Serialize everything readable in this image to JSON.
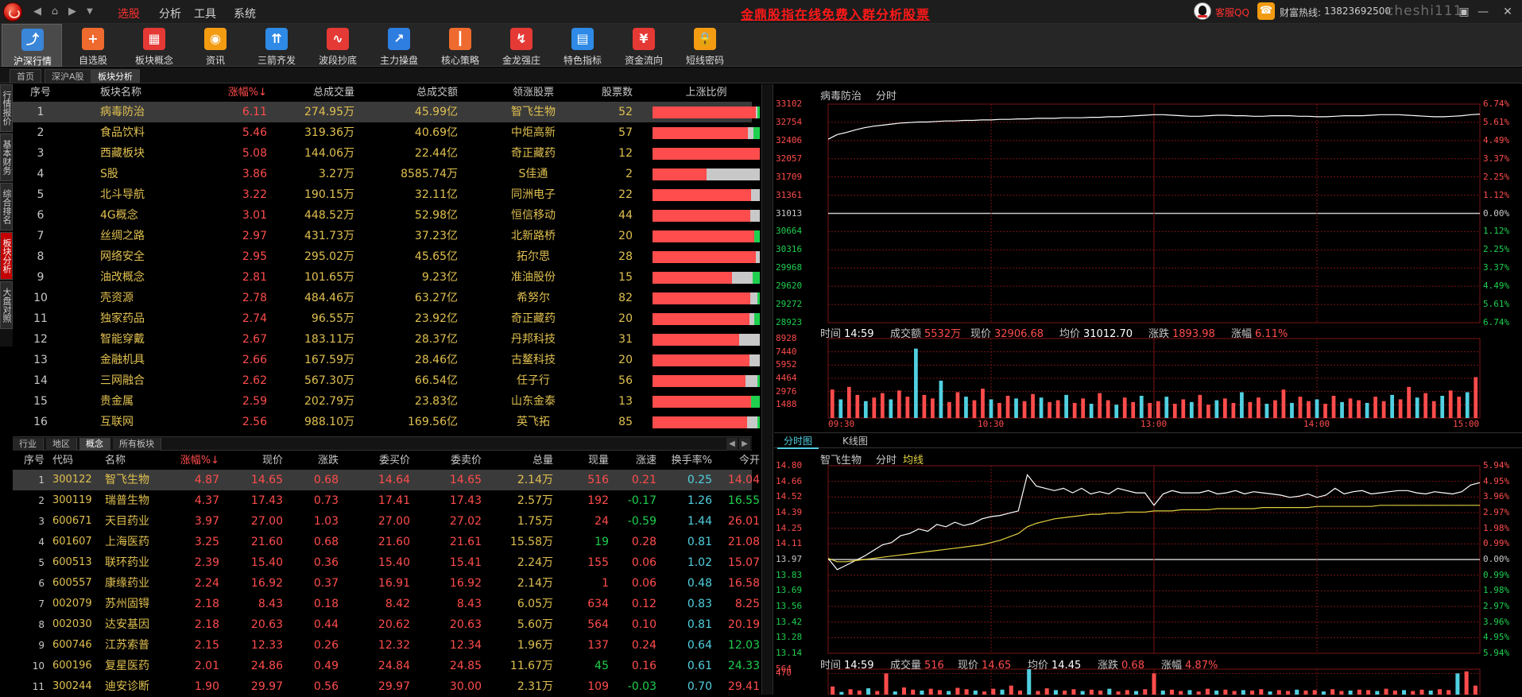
{
  "titlebar": {
    "menus": [
      "选股",
      "分析",
      "工具",
      "系统"
    ],
    "active_menu": 0,
    "marquee": "金鼎股指在线免费入群分析股票",
    "qq_label": "客服QQ",
    "hotline_label": "财富热线:",
    "hotline_number": "13823692500",
    "watermark": "cheshi111"
  },
  "toolbar": {
    "items": [
      {
        "label": "沪深行情",
        "icon": "line-chart-icon",
        "color": "#3a86d8",
        "glyph": "⤴"
      },
      {
        "label": "自选股",
        "icon": "plus-icon",
        "color": "#ef6a2e",
        "glyph": "+"
      },
      {
        "label": "板块概念",
        "icon": "grid-icon",
        "color": "#e53935",
        "glyph": "▦"
      },
      {
        "label": "资讯",
        "icon": "rss-icon",
        "color": "#f39c12",
        "glyph": "◉"
      },
      {
        "label": "三箭齐发",
        "icon": "bar-arrow-icon",
        "color": "#2e8ae6",
        "glyph": "⇈"
      },
      {
        "label": "波段抄底",
        "icon": "wave-icon",
        "color": "#e53935",
        "glyph": "∿"
      },
      {
        "label": "主力操盘",
        "icon": "chart-up-icon",
        "color": "#2e7de0",
        "glyph": "↗"
      },
      {
        "label": "核心策略",
        "icon": "candle-icon",
        "color": "#ef6a2e",
        "glyph": "┃"
      },
      {
        "label": "金龙强庄",
        "icon": "trend-icon",
        "color": "#e53935",
        "glyph": "↯"
      },
      {
        "label": "特色指标",
        "icon": "indicator-icon",
        "color": "#2e8ae6",
        "glyph": "▤"
      },
      {
        "label": "资金流向",
        "icon": "money-icon",
        "color": "#e53935",
        "glyph": "¥"
      },
      {
        "label": "短线密码",
        "icon": "lock-icon",
        "color": "#f39c12",
        "glyph": "🔒"
      }
    ],
    "active": 0
  },
  "page_tabs": [
    "首页",
    "深沪A股",
    "板块分析"
  ],
  "active_page_tab": 2,
  "vertical_tabs": [
    "行情报价",
    "基本财务",
    "综合排名",
    "板块分析",
    "大盘对照"
  ],
  "active_vertical_tab": 3,
  "sector_table": {
    "headers": [
      "序号",
      "板块名称",
      "涨幅%↓",
      "总成交量",
      "总成交额",
      "领涨股票",
      "股票数",
      "上涨比例"
    ],
    "rows": [
      {
        "seq": "1",
        "name": "病毒防治",
        "pct": "6.11",
        "vol": "274.95万",
        "amt": "45.99亿",
        "lead": "智飞生物",
        "count": "52",
        "up": 0.96,
        "down": 0.02
      },
      {
        "seq": "2",
        "name": "食品饮料",
        "pct": "5.46",
        "vol": "319.36万",
        "amt": "40.69亿",
        "lead": "中炬高新",
        "count": "57",
        "up": 0.89,
        "down": 0.06
      },
      {
        "seq": "3",
        "name": "西藏板块",
        "pct": "5.08",
        "vol": "144.06万",
        "amt": "22.44亿",
        "lead": "奇正藏药",
        "count": "12",
        "up": 1.0,
        "down": 0.0
      },
      {
        "seq": "4",
        "name": "S股",
        "pct": "3.86",
        "vol": "3.27万",
        "amt": "8585.74万",
        "lead": "S佳通",
        "count": "2",
        "up": 0.5,
        "down": 0.0
      },
      {
        "seq": "5",
        "name": "北斗导航",
        "pct": "3.22",
        "vol": "190.15万",
        "amt": "32.11亿",
        "lead": "同洲电子",
        "count": "22",
        "up": 0.92,
        "down": 0.0
      },
      {
        "seq": "6",
        "name": "4G概念",
        "pct": "3.01",
        "vol": "448.52万",
        "amt": "52.98亿",
        "lead": "恒信移动",
        "count": "44",
        "up": 0.91,
        "down": 0.0
      },
      {
        "seq": "7",
        "name": "丝绸之路",
        "pct": "2.97",
        "vol": "431.73万",
        "amt": "37.23亿",
        "lead": "北新路桥",
        "count": "20",
        "up": 0.95,
        "down": 0.05
      },
      {
        "seq": "8",
        "name": "网络安全",
        "pct": "2.95",
        "vol": "295.02万",
        "amt": "45.65亿",
        "lead": "拓尔思",
        "count": "28",
        "up": 0.96,
        "down": 0.0
      },
      {
        "seq": "9",
        "name": "油改概念",
        "pct": "2.81",
        "vol": "101.65万",
        "amt": "9.23亿",
        "lead": "准油股份",
        "count": "15",
        "up": 0.74,
        "down": 0.07
      },
      {
        "seq": "10",
        "name": "壳资源",
        "pct": "2.78",
        "vol": "484.46万",
        "amt": "63.27亿",
        "lead": "希努尔",
        "count": "82",
        "up": 0.91,
        "down": 0.02
      },
      {
        "seq": "11",
        "name": "独家药品",
        "pct": "2.74",
        "vol": "96.55万",
        "amt": "23.92亿",
        "lead": "奇正藏药",
        "count": "20",
        "up": 0.9,
        "down": 0.05
      },
      {
        "seq": "12",
        "name": "智能穿戴",
        "pct": "2.67",
        "vol": "183.11万",
        "amt": "28.37亿",
        "lead": "丹邦科技",
        "count": "31",
        "up": 0.81,
        "down": 0.0
      },
      {
        "seq": "13",
        "name": "金融机具",
        "pct": "2.66",
        "vol": "167.59万",
        "amt": "28.46亿",
        "lead": "古鳌科技",
        "count": "20",
        "up": 0.9,
        "down": 0.0
      },
      {
        "seq": "14",
        "name": "三网融合",
        "pct": "2.62",
        "vol": "567.30万",
        "amt": "66.54亿",
        "lead": "任子行",
        "count": "56",
        "up": 0.87,
        "down": 0.02
      },
      {
        "seq": "15",
        "name": "贵金属",
        "pct": "2.59",
        "vol": "202.79万",
        "amt": "23.83亿",
        "lead": "山东金泰",
        "count": "13",
        "up": 0.92,
        "down": 0.08
      },
      {
        "seq": "16",
        "name": "互联网",
        "pct": "2.56",
        "vol": "988.10万",
        "amt": "169.56亿",
        "lead": "英飞拓",
        "count": "85",
        "up": 0.88,
        "down": 0.02
      }
    ]
  },
  "category_tabs": [
    "行业",
    "地区",
    "概念",
    "所有板块"
  ],
  "active_category_tab": 2,
  "stock_table": {
    "headers": [
      "序号",
      "代码",
      "名称",
      "涨幅%↓",
      "现价",
      "涨跌",
      "委买价",
      "委卖价",
      "总量",
      "现量",
      "涨速",
      "换手率%",
      "今开"
    ],
    "rows": [
      {
        "seq": "1",
        "code": "300122",
        "name": "智飞生物",
        "pct": "4.87",
        "price": "14.65",
        "chg": "0.68",
        "bid": "14.64",
        "ask": "14.65",
        "tot": "2.14万",
        "cur": "516",
        "spd": "0.21",
        "turn": "0.25",
        "open": "14.04"
      },
      {
        "seq": "2",
        "code": "300119",
        "name": "瑞普生物",
        "pct": "4.37",
        "price": "17.43",
        "chg": "0.73",
        "bid": "17.41",
        "ask": "17.43",
        "tot": "2.57万",
        "cur": "192",
        "spd": "-0.17",
        "turn": "1.26",
        "open": "16.55"
      },
      {
        "seq": "3",
        "code": "600671",
        "name": "天目药业",
        "pct": "3.97",
        "price": "27.00",
        "chg": "1.03",
        "bid": "27.00",
        "ask": "27.02",
        "tot": "1.75万",
        "cur": "24",
        "spd": "-0.59",
        "turn": "1.44",
        "open": "26.01"
      },
      {
        "seq": "4",
        "code": "601607",
        "name": "上海医药",
        "pct": "3.25",
        "price": "21.60",
        "chg": "0.68",
        "bid": "21.60",
        "ask": "21.61",
        "tot": "15.58万",
        "cur": "19",
        "spd": "0.28",
        "turn": "0.81",
        "open": "21.08"
      },
      {
        "seq": "5",
        "code": "600513",
        "name": "联环药业",
        "pct": "2.39",
        "price": "15.40",
        "chg": "0.36",
        "bid": "15.40",
        "ask": "15.41",
        "tot": "2.24万",
        "cur": "155",
        "spd": "0.06",
        "turn": "1.02",
        "open": "15.07"
      },
      {
        "seq": "6",
        "code": "600557",
        "name": "康缘药业",
        "pct": "2.24",
        "price": "16.92",
        "chg": "0.37",
        "bid": "16.91",
        "ask": "16.92",
        "tot": "2.14万",
        "cur": "1",
        "spd": "0.06",
        "turn": "0.48",
        "open": "16.58"
      },
      {
        "seq": "7",
        "code": "002079",
        "name": "苏州固锝",
        "pct": "2.18",
        "price": "8.43",
        "chg": "0.18",
        "bid": "8.42",
        "ask": "8.43",
        "tot": "6.05万",
        "cur": "634",
        "spd": "0.12",
        "turn": "0.83",
        "open": "8.25"
      },
      {
        "seq": "8",
        "code": "002030",
        "name": "达安基因",
        "pct": "2.18",
        "price": "20.63",
        "chg": "0.44",
        "bid": "20.62",
        "ask": "20.63",
        "tot": "5.60万",
        "cur": "564",
        "spd": "0.10",
        "turn": "0.81",
        "open": "20.19"
      },
      {
        "seq": "9",
        "code": "600746",
        "name": "江苏索普",
        "pct": "2.15",
        "price": "12.33",
        "chg": "0.26",
        "bid": "12.32",
        "ask": "12.34",
        "tot": "1.96万",
        "cur": "137",
        "spd": "0.24",
        "turn": "0.64",
        "open": "12.03"
      },
      {
        "seq": "10",
        "code": "600196",
        "name": "复星医药",
        "pct": "2.01",
        "price": "24.86",
        "chg": "0.49",
        "bid": "24.84",
        "ask": "24.85",
        "tot": "11.67万",
        "cur": "45",
        "spd": "0.16",
        "turn": "0.61",
        "open": "24.33"
      },
      {
        "seq": "11",
        "code": "300244",
        "name": "迪安诊断",
        "pct": "1.90",
        "price": "29.97",
        "chg": "0.56",
        "bid": "29.97",
        "ask": "30.00",
        "tot": "2.31万",
        "cur": "109",
        "spd": "-0.03",
        "turn": "0.70",
        "open": "29.41"
      }
    ]
  },
  "chart_tabs": [
    "分时图",
    "K线图"
  ],
  "active_chart_tab": 0,
  "chart_data": [
    {
      "type": "line",
      "title": "病毒防治",
      "subtitle": "分时",
      "y_left": [
        "33102",
        "32754",
        "32406",
        "32057",
        "31709",
        "31361",
        "31013",
        "30664",
        "30316",
        "29968",
        "29620",
        "29272",
        "28923"
      ],
      "y_right": [
        "6.74%",
        "5.61%",
        "4.49%",
        "3.37%",
        "2.25%",
        "1.12%",
        "0.00%",
        "1.12%",
        "2.25%",
        "3.37%",
        "4.49%",
        "5.61%",
        "6.74%"
      ],
      "ylim": [
        28923,
        33102
      ],
      "base": 31013,
      "series": [
        {
          "values": [
            32430,
            32520,
            32560,
            32610,
            32650,
            32680,
            32700,
            32720,
            32740,
            32750,
            32760,
            32760,
            32770,
            32780,
            32780,
            32790,
            32790,
            32800,
            32800,
            32810,
            32810,
            32820,
            32820,
            32830,
            32830,
            32830,
            32840,
            32840,
            32840,
            32850,
            32850,
            32860,
            32860,
            32870,
            32880,
            32890,
            32900,
            32900,
            32890,
            32880,
            32870,
            32870,
            32880,
            32890,
            32890,
            32880,
            32880,
            32870,
            32870,
            32880,
            32880,
            32880,
            32870,
            32870,
            32860,
            32860,
            32870,
            32880,
            32880,
            32880,
            32890,
            32900,
            32900,
            32900,
            32890,
            32880,
            32870,
            32860,
            32860,
            32870,
            32880,
            32900,
            32910
          ]
        }
      ]
    },
    {
      "type": "bar",
      "title": "",
      "info": [
        {
          "k": "时间",
          "v": "14:59",
          "c": "v"
        },
        {
          "k": "成交额",
          "v": "5532万",
          "c": "r"
        },
        {
          "k": "现价",
          "v": "32906.68",
          "c": "r"
        },
        {
          "k": "均价",
          "v": "31012.70",
          "c": "v"
        },
        {
          "k": "涨跌",
          "v": "1893.98",
          "c": "r"
        },
        {
          "k": "涨幅",
          "v": "6.11%",
          "c": "r"
        }
      ],
      "y_left": [
        "8928",
        "7440",
        "5952",
        "4464",
        "2976",
        "1488"
      ],
      "ylim": [
        0,
        8928
      ],
      "x_ticks": [
        "09:30",
        "10:30",
        "13:00",
        "14:00",
        "15:00"
      ],
      "values": [
        3200,
        2100,
        3500,
        2600,
        1900,
        2300,
        2800,
        2100,
        3100,
        2400,
        7800,
        2600,
        2200,
        4200,
        1800,
        2900,
        2400,
        2000,
        3300,
        2100,
        1700,
        2500,
        2200,
        1900,
        2700,
        2300,
        1800,
        2000,
        2600,
        1700,
        2200,
        1600,
        2800,
        2000,
        1500,
        2300,
        1800,
        2500,
        1700,
        1900,
        2400,
        1600,
        2100,
        1800,
        2600,
        1500,
        2000,
        2200,
        1700,
        2900,
        1800,
        2300,
        1600,
        2000,
        3200,
        1700,
        2400,
        1900,
        2100,
        1600,
        2500,
        1800,
        2200,
        2000,
        1700,
        2400,
        1900,
        2600,
        2100,
        3500,
        2300,
        2800,
        1900,
        2500,
        3100,
        2400,
        2900,
        4600
      ]
    },
    {
      "type": "line",
      "title": "智飞生物",
      "subtitle": "分时",
      "legend": "均线",
      "y_left": [
        "14.80",
        "14.66",
        "14.52",
        "14.39",
        "14.25",
        "14.11",
        "13.97",
        "13.83",
        "13.69",
        "13.56",
        "13.42",
        "13.28",
        "13.14"
      ],
      "y_right": [
        "5.94%",
        "4.95%",
        "3.96%",
        "2.97%",
        "1.98%",
        "0.99%",
        "0.00%",
        "0.99%",
        "1.98%",
        "2.97%",
        "3.96%",
        "4.95%",
        "5.94%"
      ],
      "ylim": [
        13.14,
        14.8
      ],
      "base": 13.97,
      "series": [
        {
          "name": "分时",
          "values": [
            13.98,
            13.88,
            13.92,
            13.96,
            14.0,
            14.05,
            14.1,
            14.12,
            14.18,
            14.2,
            14.24,
            14.22,
            14.28,
            14.26,
            14.3,
            14.27,
            14.29,
            14.33,
            14.35,
            14.36,
            14.38,
            14.4,
            14.72,
            14.62,
            14.6,
            14.58,
            14.6,
            14.56,
            14.6,
            14.55,
            14.57,
            14.55,
            14.6,
            14.58,
            14.56,
            14.56,
            14.45,
            14.55,
            14.58,
            14.56,
            14.56,
            14.56,
            14.58,
            14.55,
            14.56,
            14.58,
            14.55,
            14.57,
            14.56,
            14.55,
            14.54,
            14.52,
            14.53,
            14.55,
            14.52,
            14.54,
            14.6,
            14.55,
            14.57,
            14.58,
            14.55,
            14.56,
            14.57,
            14.58,
            14.58,
            14.56,
            14.55,
            14.57,
            14.56,
            14.55,
            14.57,
            14.63,
            14.65
          ]
        },
        {
          "name": "均线",
          "values": [
            13.98,
            13.95,
            13.95,
            13.96,
            13.97,
            13.98,
            13.99,
            14.0,
            14.01,
            14.02,
            14.03,
            14.04,
            14.05,
            14.06,
            14.07,
            14.08,
            14.09,
            14.1,
            14.12,
            14.14,
            14.17,
            14.2,
            14.26,
            14.29,
            14.31,
            14.33,
            14.34,
            14.35,
            14.36,
            14.37,
            14.37,
            14.38,
            14.38,
            14.39,
            14.39,
            14.39,
            14.4,
            14.4,
            14.4,
            14.41,
            14.41,
            14.41,
            14.41,
            14.42,
            14.42,
            14.42,
            14.42,
            14.42,
            14.43,
            14.43,
            14.43,
            14.43,
            14.43,
            14.43,
            14.44,
            14.44,
            14.44,
            14.44,
            14.44,
            14.44,
            14.44,
            14.45,
            14.45,
            14.45,
            14.45,
            14.45,
            14.45,
            14.45,
            14.45,
            14.45,
            14.45,
            14.45,
            14.45
          ]
        }
      ]
    },
    {
      "type": "bar",
      "title": "",
      "info": [
        {
          "k": "时间",
          "v": "14:59",
          "c": "v"
        },
        {
          "k": "成交量",
          "v": "516",
          "c": "r"
        },
        {
          "k": "现价",
          "v": "14.65",
          "c": "r"
        },
        {
          "k": "均价",
          "v": "14.45",
          "c": "v"
        },
        {
          "k": "涨跌",
          "v": "0.68",
          "c": "r"
        },
        {
          "k": "涨幅",
          "v": "4.87%",
          "c": "r"
        }
      ],
      "y_left": [
        "564",
        "470"
      ],
      "ylim": [
        0,
        564
      ],
      "values": [
        180,
        60,
        120,
        90,
        140,
        80,
        470,
        70,
        160,
        110,
        90,
        130,
        100,
        80,
        150,
        120,
        90,
        70,
        130,
        110,
        200,
        90,
        564,
        80,
        140,
        100,
        90,
        120,
        80,
        110,
        90,
        130,
        70,
        100,
        80,
        120,
        470,
        90,
        110,
        80,
        100,
        70,
        130,
        90,
        110,
        80,
        100,
        90,
        120,
        70,
        100,
        80,
        110,
        90,
        100,
        70,
        120,
        80,
        90,
        110,
        100,
        80,
        130,
        90,
        100,
        80,
        110,
        90,
        120,
        100,
        470,
        516,
        200
      ]
    }
  ],
  "colors": {
    "up": "#ff4c4c",
    "down": "#1fd04f",
    "accent": "#e0c050",
    "cyan": "#50d0e0",
    "grid": "#7a1414"
  }
}
